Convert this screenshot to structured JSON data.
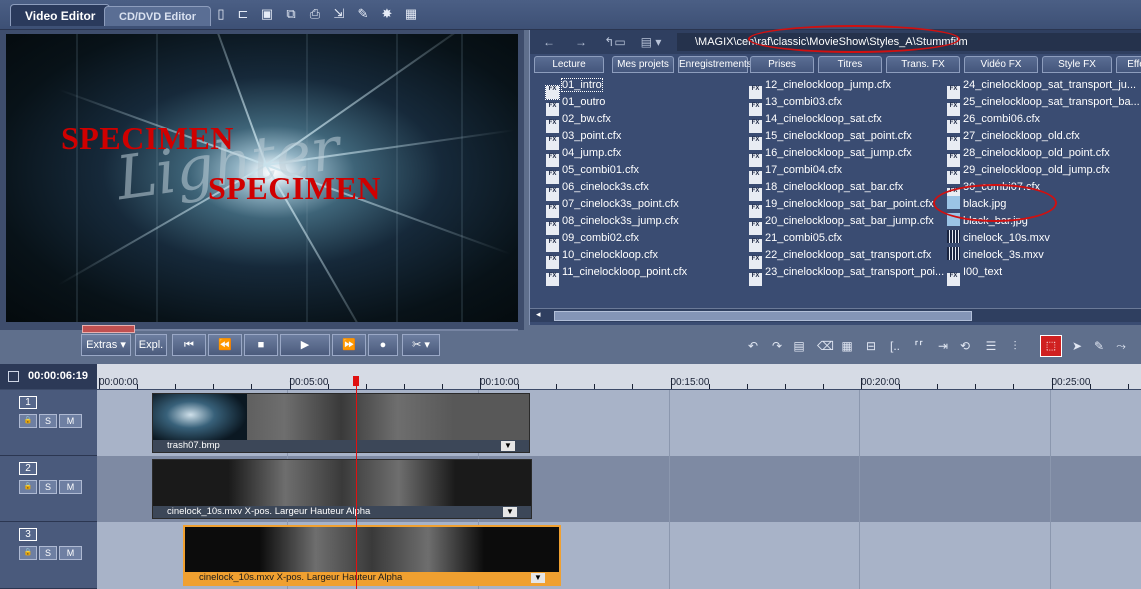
{
  "tabs": {
    "video_editor": "Video Editor",
    "cddvd_editor": "CD/DVD Editor"
  },
  "toolbar_icons": [
    "new-icon",
    "open-icon",
    "save-icon",
    "save-as-icon",
    "print-icon",
    "export-icon",
    "effects-icon",
    "wizard-icon",
    "grid-icon"
  ],
  "monitor": {
    "watermark_1": "SPECIMEN",
    "watermark_2": "SPECIMEN"
  },
  "transport": {
    "extras": "Extras",
    "expl": "Expl."
  },
  "browser": {
    "path": "\\MAGIX\\cen\\raf\\classic\\MovieShow\\Styles_A\\Stummfilm",
    "tabs": [
      "Lecture",
      "Mes projets",
      "Enregistrements",
      "Prises",
      "Titres",
      "Trans. FX",
      "Vidéo FX",
      "Style FX",
      "Effe"
    ],
    "files_col1": [
      "01_intro",
      "01_outro",
      "02_bw.cfx",
      "03_point.cfx",
      "04_jump.cfx",
      "05_combi01.cfx",
      "06_cinelock3s.cfx",
      "07_cinelock3s_point.cfx",
      "08_cinelock3s_jump.cfx",
      "09_combi02.cfx",
      "10_cinelockloop.cfx",
      "11_cinelockloop_point.cfx"
    ],
    "files_col2": [
      "12_cinelockloop_jump.cfx",
      "13_combi03.cfx",
      "14_cinelockloop_sat.cfx",
      "15_cinelockloop_sat_point.cfx",
      "16_cinelockloop_sat_jump.cfx",
      "17_combi04.cfx",
      "18_cinelockloop_sat_bar.cfx",
      "19_cinelockloop_sat_bar_point.cfx",
      "20_cinelockloop_sat_bar_jump.cfx",
      "21_combi05.cfx",
      "22_cinelockloop_sat_transport.cfx",
      "23_cinelockloop_sat_transport_poi..."
    ],
    "files_col3": [
      "24_cinelockloop_sat_transport_ju...",
      "25_cinelockloop_sat_transport_ba...",
      "26_combi06.cfx",
      "27_cinelockloop_old.cfx",
      "28_cinelockloop_old_point.cfx",
      "29_cinelockloop_old_jump.cfx",
      "30_combi07.cfx",
      "black.jpg",
      "black_bar.jpg",
      "cinelock_10s.mxv",
      "cinelock_3s.mxv",
      "I00_text"
    ]
  },
  "timeline": {
    "timecode": "00:00:06:19",
    "ruler": [
      "00:00:00",
      "00:05:00",
      "00:10:00",
      "00:15:00",
      "00:20:00",
      "00:25:00"
    ],
    "tracks": [
      {
        "num": "1",
        "s": "S",
        "m": "M",
        "clip_label": "trash07.bmp"
      },
      {
        "num": "2",
        "s": "S",
        "m": "M",
        "clip_label": "cinelock_10s.mxv   X-pos.  Largeur  Hauteur Alpha"
      },
      {
        "num": "3",
        "s": "S",
        "m": "M",
        "clip_label": "cinelock_10s.mxv   X-pos.  Largeur  Hauteur Alpha"
      }
    ]
  },
  "colors": {
    "accent": "#d01010",
    "selected_clip": "#f0a030"
  }
}
